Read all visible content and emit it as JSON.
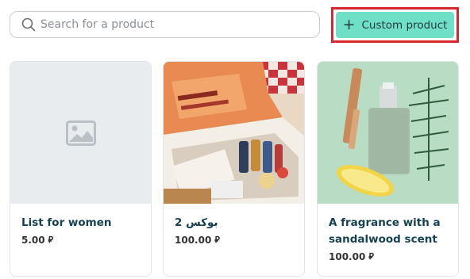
{
  "search": {
    "placeholder": "Search for a product",
    "value": ""
  },
  "toolbar": {
    "custom_product_label": "Custom product"
  },
  "currency_symbol": "⃁",
  "products": [
    {
      "name": "List for women",
      "price": "5.00"
    },
    {
      "name": "بوكس 2",
      "price": "100.00"
    },
    {
      "name": "A fragrance with a sandalwood scent",
      "price": "100.00"
    }
  ],
  "colors": {
    "accent": "#6fe0c6",
    "highlight_border": "#d7262d",
    "title_text": "#16414f"
  }
}
